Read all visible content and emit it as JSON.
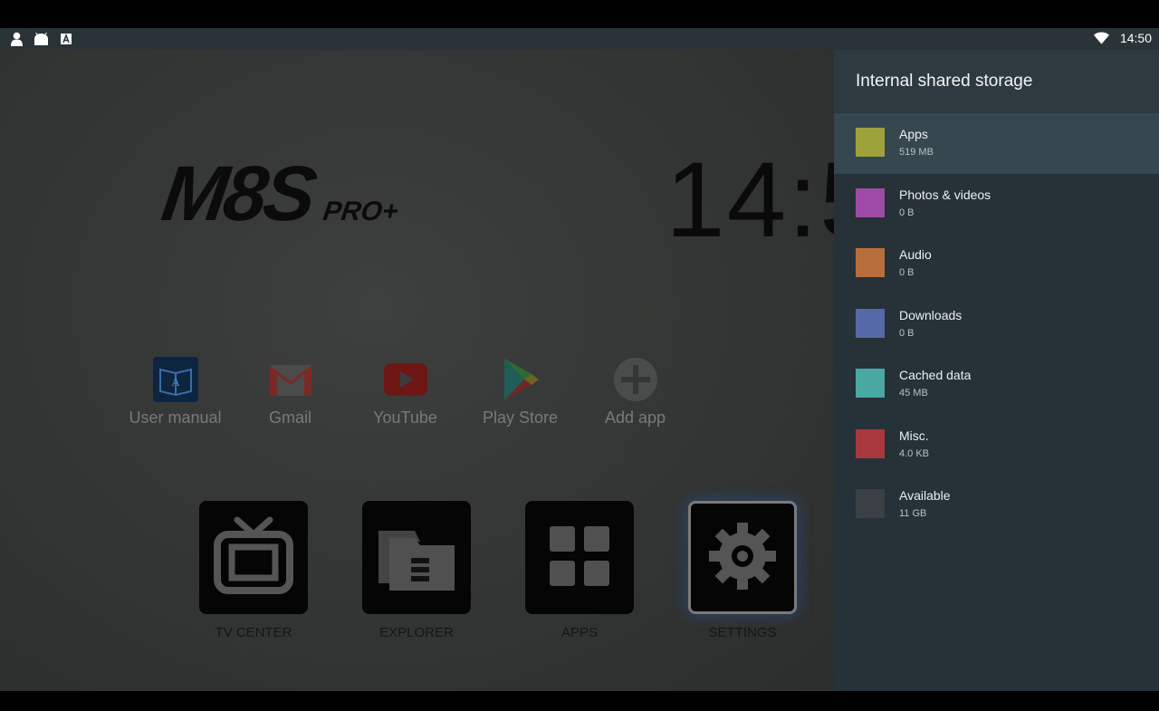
{
  "status_bar": {
    "time": "14:50",
    "left_icons": [
      "person-icon",
      "android-icon",
      "text-a-icon"
    ],
    "right_icons": [
      "wifi-icon"
    ]
  },
  "launcher": {
    "brand_main": "M8S",
    "brand_sub": "PRO+",
    "clock": "14:5",
    "apps": [
      {
        "label": "User manual",
        "icon": "user-manual-icon"
      },
      {
        "label": "Gmail",
        "icon": "gmail-icon"
      },
      {
        "label": "YouTube",
        "icon": "youtube-icon"
      },
      {
        "label": "Play Store",
        "icon": "play-store-icon"
      },
      {
        "label": "Add app",
        "icon": "add-app-icon"
      }
    ],
    "tiles": [
      {
        "label": "TV CENTER",
        "icon": "tv-icon",
        "selected": false
      },
      {
        "label": "EXPLORER",
        "icon": "folder-icon",
        "selected": false
      },
      {
        "label": "APPS",
        "icon": "grid-icon",
        "selected": false
      },
      {
        "label": "SETTINGS",
        "icon": "gear-icon",
        "selected": true
      }
    ]
  },
  "storage_panel": {
    "title": "Internal shared storage",
    "items": [
      {
        "label": "Apps",
        "size": "519 MB",
        "color": "#9ea23a",
        "active": true
      },
      {
        "label": "Photos & videos",
        "size": "0 B",
        "color": "#a04aa8",
        "active": false
      },
      {
        "label": "Audio",
        "size": "0 B",
        "color": "#b86e3c",
        "active": false
      },
      {
        "label": "Downloads",
        "size": "0 B",
        "color": "#5568a8",
        "active": false
      },
      {
        "label": "Cached data",
        "size": "45 MB",
        "color": "#4aa8a2",
        "active": false
      },
      {
        "label": "Misc.",
        "size": "4.0 KB",
        "color": "#a8383e",
        "active": false
      },
      {
        "label": "Available",
        "size": "11 GB",
        "color": "#3a4043",
        "active": false
      }
    ]
  }
}
